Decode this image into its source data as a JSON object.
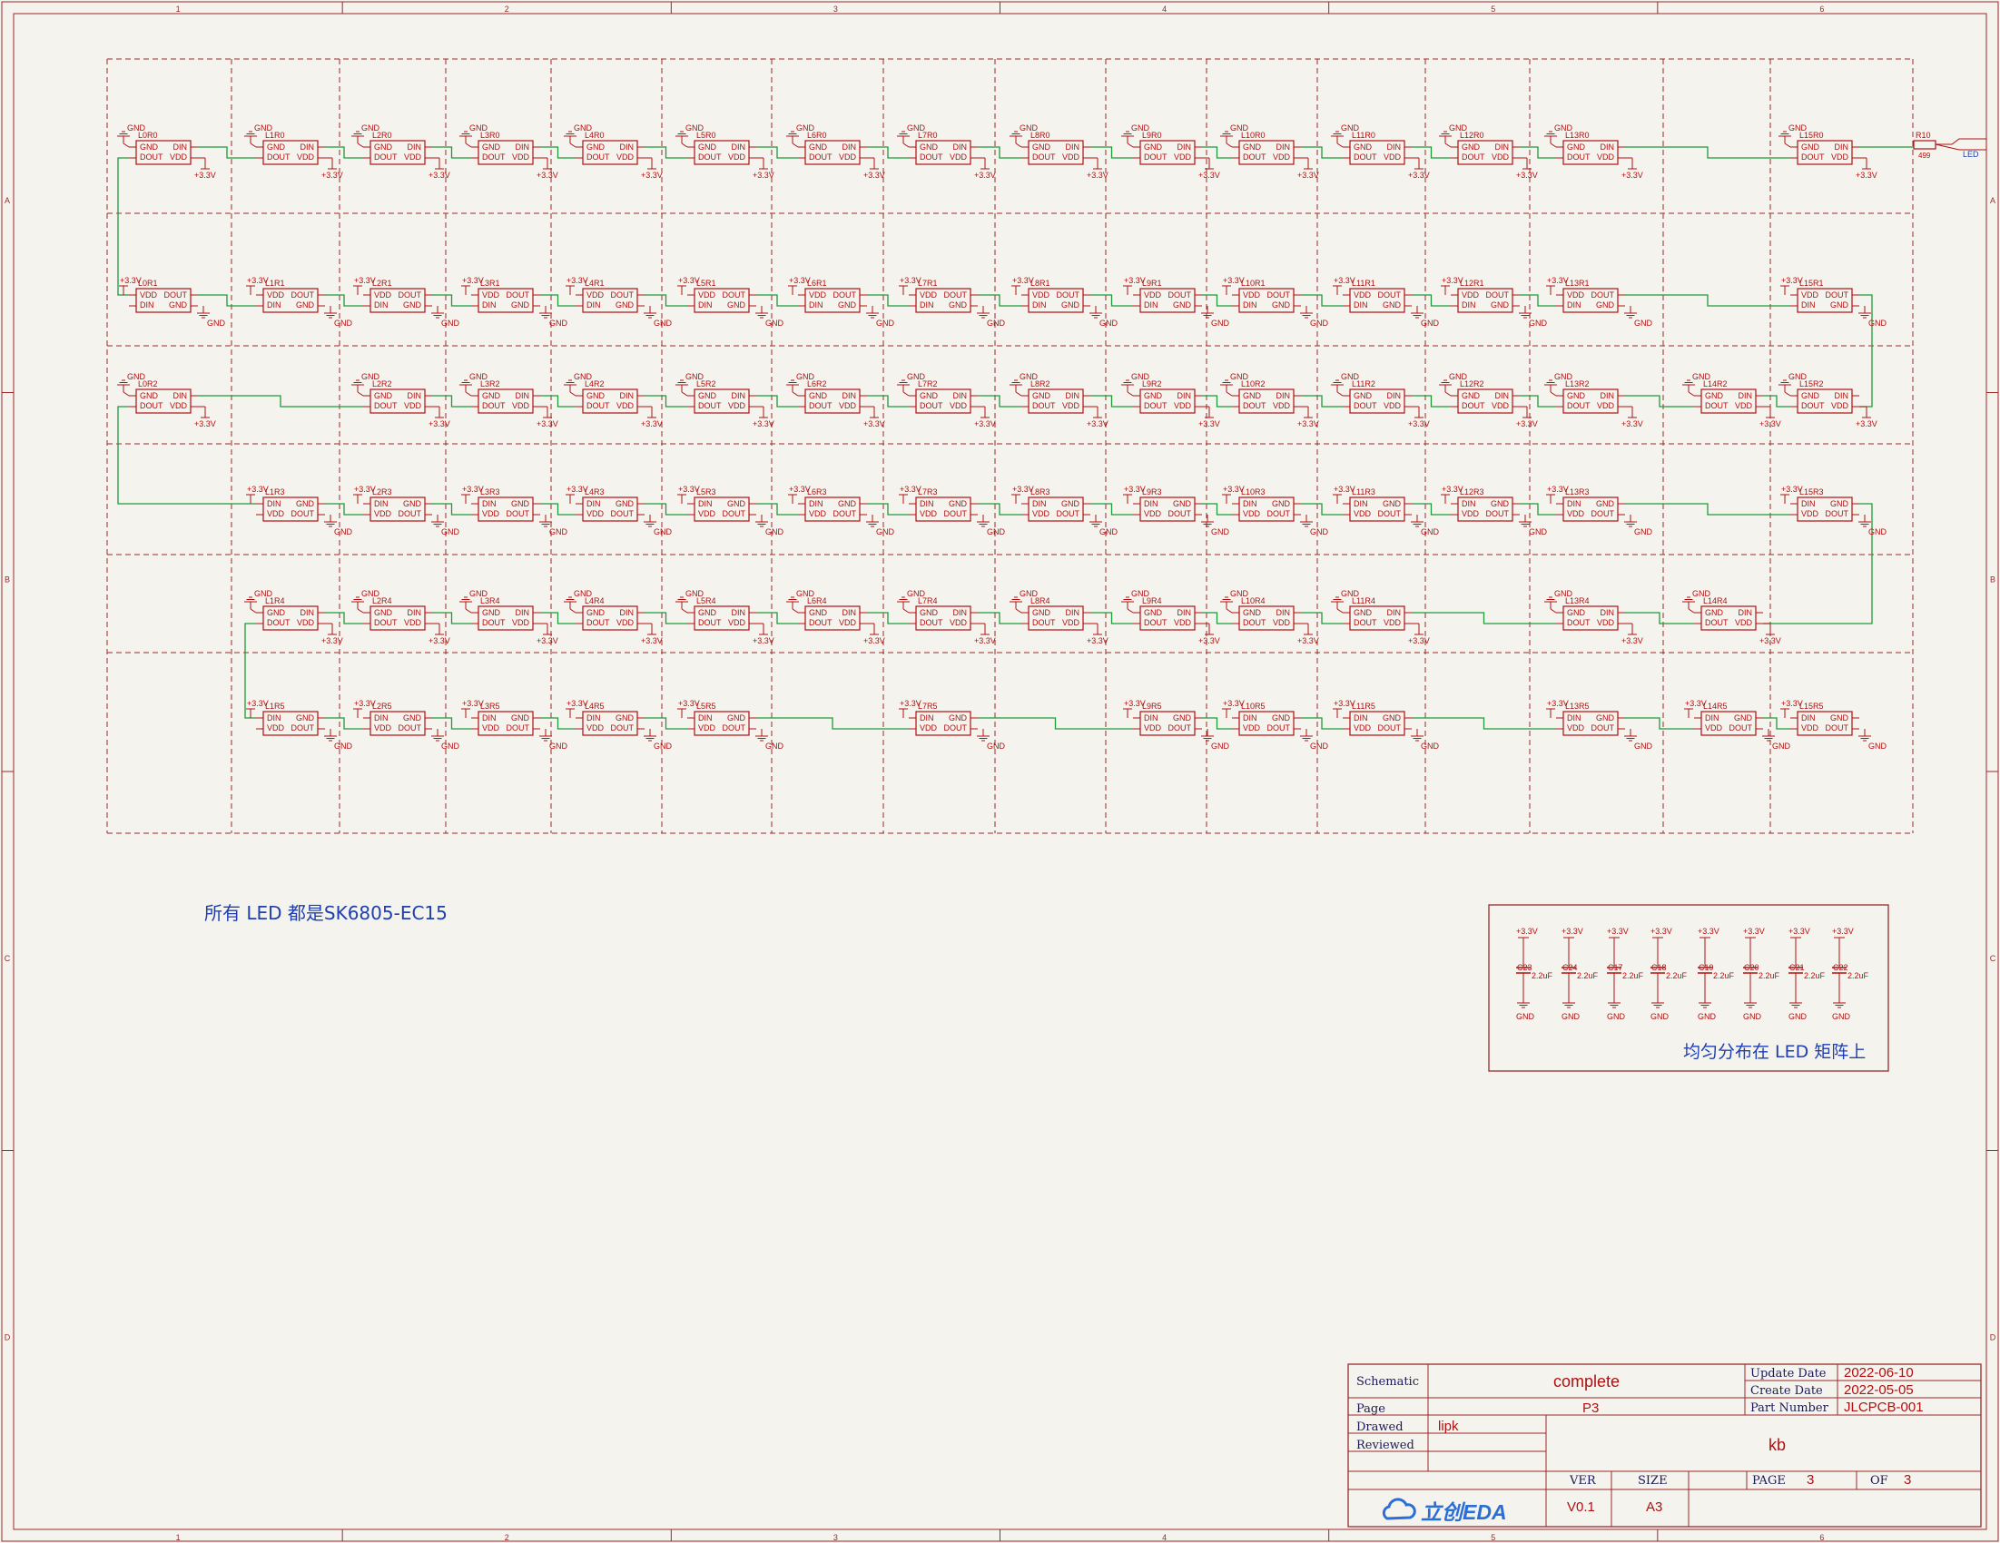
{
  "zone_numbers": [
    "1",
    "2",
    "3",
    "4",
    "5",
    "6"
  ],
  "zone_letters": [
    "A",
    "B",
    "C",
    "D"
  ],
  "matrix": {
    "rows": [
      {
        "suffix": "R0",
        "orient": "a",
        "pins": [
          "GND",
          "DIN",
          "DOUT",
          "VDD"
        ]
      },
      {
        "suffix": "R1",
        "orient": "b",
        "pins": [
          "VDD",
          "DOUT",
          "DIN",
          "GND"
        ]
      },
      {
        "suffix": "R2",
        "orient": "a",
        "pins": [
          "GND",
          "DIN",
          "DOUT",
          "VDD"
        ]
      },
      {
        "suffix": "R3",
        "orient": "b",
        "pins": [
          "DIN",
          "GND",
          "VDD",
          "DOUT"
        ]
      },
      {
        "suffix": "R4",
        "orient": "a",
        "pins": [
          "GND",
          "DIN",
          "DOUT",
          "VDD"
        ]
      },
      {
        "suffix": "R5",
        "orient": "b",
        "pins": [
          "DIN",
          "GND",
          "VDD",
          "DOUT"
        ]
      }
    ],
    "cells": [
      [
        1,
        1,
        1,
        1,
        1,
        1,
        1,
        1,
        1,
        1,
        1,
        1,
        1,
        1,
        0,
        1
      ],
      [
        1,
        1,
        1,
        1,
        1,
        1,
        1,
        1,
        1,
        1,
        1,
        1,
        1,
        1,
        0,
        1
      ],
      [
        1,
        0,
        1,
        1,
        1,
        1,
        1,
        1,
        1,
        1,
        1,
        1,
        1,
        1,
        1,
        1
      ],
      [
        0,
        1,
        1,
        1,
        1,
        1,
        1,
        1,
        1,
        1,
        1,
        1,
        1,
        1,
        0,
        1
      ],
      [
        0,
        1,
        1,
        1,
        1,
        1,
        1,
        1,
        1,
        1,
        1,
        1,
        0,
        1,
        1,
        0
      ],
      [
        0,
        1,
        1,
        1,
        1,
        1,
        0,
        1,
        0,
        1,
        1,
        1,
        0,
        1,
        1,
        1
      ]
    ],
    "power_label": "+3.3V",
    "ground_label": "GND",
    "resistor": {
      "ref": "R10",
      "value": "499"
    },
    "net_label": "LED"
  },
  "capacitors": {
    "items": [
      "C23",
      "C24",
      "C17",
      "C18",
      "C19",
      "C20",
      "C21",
      "C22"
    ],
    "value": "2.2uF",
    "power_label": "+3.3V",
    "ground_label": "GND"
  },
  "notes": {
    "all_led": "所有 LED 都是SK6805-EC15",
    "cap_note": "均匀分布在 LED 矩阵上"
  },
  "title_block": {
    "schematic_label": "Schematic",
    "schematic_value": "complete",
    "page_label": "Page",
    "page_value": "P3",
    "drawed_label": "Drawed",
    "drawed_value": "lipk",
    "reviewed_label": "Reviewed",
    "project": "kb",
    "update_label": "Update Date",
    "update_value": "2022-06-10",
    "create_label": "Create Date",
    "create_value": "2022-05-05",
    "part_label": "Part Number",
    "part_value": "JLCPCB-001",
    "ver_label": "VER",
    "ver_value": "V0.1",
    "size_label": "SIZE",
    "size_value": "A3",
    "page_of_label": "PAGE",
    "page_num": "3",
    "of_label": "OF",
    "page_total": "3",
    "logo_text": "立创EDA"
  },
  "colors": {
    "frame": "#9c2a2a",
    "component": "#b01010",
    "wire": "#1f9a3a",
    "text_blue": "#1f3fb0",
    "paper": "#f4f3ee"
  }
}
